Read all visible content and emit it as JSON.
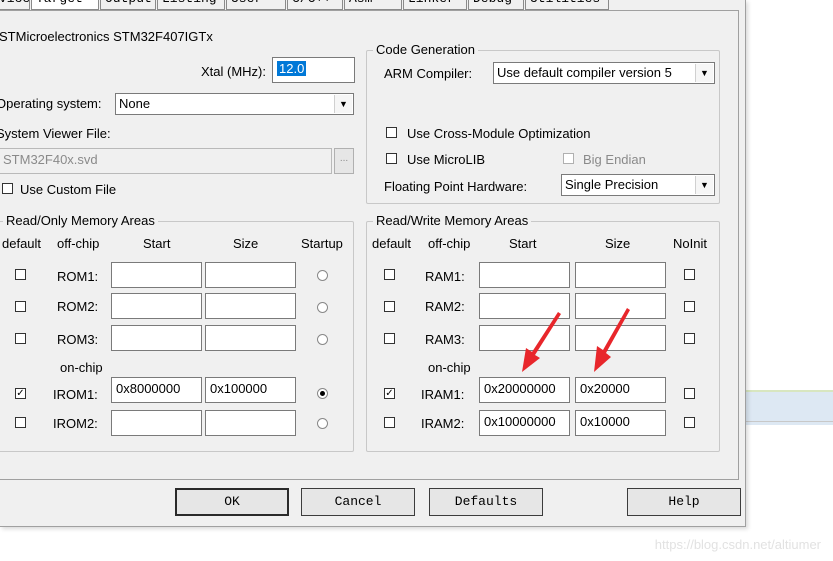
{
  "tabs": [
    {
      "label": "vice",
      "active": false
    },
    {
      "label": "Target",
      "active": true
    },
    {
      "label": "Output",
      "active": false
    },
    {
      "label": "Listing",
      "active": false
    },
    {
      "label": "User",
      "active": false
    },
    {
      "label": "C/C++",
      "active": false
    },
    {
      "label": "Asm",
      "active": false
    },
    {
      "label": "Linker",
      "active": false
    },
    {
      "label": "Debug",
      "active": false
    },
    {
      "label": "Utilities",
      "active": false
    }
  ],
  "device_name": "STMicroelectronics STM32F407IGTx",
  "xtal": {
    "label": "Xtal (MHz):",
    "value": "12.0"
  },
  "os": {
    "label": "Operating system:",
    "value": "None"
  },
  "svd": {
    "label": "System Viewer File:",
    "value": "STM32F40x.svd",
    "browse": "..."
  },
  "custom_file": {
    "label": "Use Custom File",
    "checked": false
  },
  "codegen": {
    "legend": "Code Generation",
    "compiler_label": "ARM Compiler:",
    "compiler_value": "Use default compiler version 5",
    "cross_module": {
      "label": "Use Cross-Module Optimization",
      "checked": false
    },
    "microlib": {
      "label": "Use MicroLIB",
      "checked": false
    },
    "big_endian": {
      "label": "Big Endian",
      "checked": false,
      "enabled": false
    },
    "fp_label": "Floating Point Hardware:",
    "fp_value": "Single Precision"
  },
  "rom": {
    "legend": "Read/Only Memory Areas",
    "headers": {
      "default": "default",
      "offchip": "off-chip",
      "start": "Start",
      "size": "Size",
      "startup": "Startup"
    },
    "onchip_label": "on-chip",
    "rows": [
      {
        "name": "ROM1:",
        "default": false,
        "start": "",
        "size": "",
        "startup": false
      },
      {
        "name": "ROM2:",
        "default": false,
        "start": "",
        "size": "",
        "startup": false
      },
      {
        "name": "ROM3:",
        "default": false,
        "start": "",
        "size": "",
        "startup": false
      },
      {
        "name": "IROM1:",
        "default": true,
        "start": "0x8000000",
        "size": "0x100000",
        "startup": true
      },
      {
        "name": "IROM2:",
        "default": false,
        "start": "",
        "size": "",
        "startup": false
      }
    ]
  },
  "ram": {
    "legend": "Read/Write Memory Areas",
    "headers": {
      "default": "default",
      "offchip": "off-chip",
      "start": "Start",
      "size": "Size",
      "noinit": "NoInit"
    },
    "onchip_label": "on-chip",
    "rows": [
      {
        "name": "RAM1:",
        "default": false,
        "start": "",
        "size": "",
        "noinit": false
      },
      {
        "name": "RAM2:",
        "default": false,
        "start": "",
        "size": "",
        "noinit": false
      },
      {
        "name": "RAM3:",
        "default": false,
        "start": "",
        "size": "",
        "noinit": false
      },
      {
        "name": "IRAM1:",
        "default": true,
        "start": "0x20000000",
        "size": "0x20000",
        "noinit": false
      },
      {
        "name": "IRAM2:",
        "default": false,
        "start": "0x10000000",
        "size": "0x10000",
        "noinit": false
      }
    ]
  },
  "buttons": {
    "ok": "OK",
    "cancel": "Cancel",
    "defaults": "Defaults",
    "help": "Help"
  },
  "check_mark": "✓",
  "dropdown_arrow": "▼",
  "annotation_color": "#e8262b",
  "watermark": "https://blog.csdn.net/altiumer"
}
